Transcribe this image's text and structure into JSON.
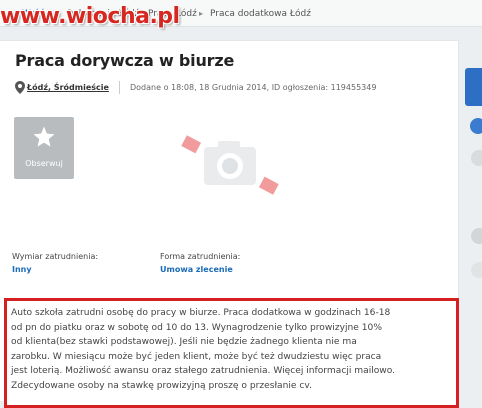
{
  "breadcrumb": {
    "items": [
      "Wróć",
      "Ogłoszenia Łódź",
      "Praca Łódź",
      "Praca dodatkowa Łódź"
    ]
  },
  "watermark": "www.wiocha.pl",
  "listing": {
    "title": "Praca dorywcza w biurze",
    "location": "Łódź, Śródmieście",
    "meta": "Dodane o 18:08, 18 Grudnia 2014, ID ogłoszenia: 119455349",
    "observe_label": "Obserwuj",
    "details": [
      {
        "label": "Wymiar zatrudnienia:",
        "value": "Inny"
      },
      {
        "label": "Forma zatrudnienia:",
        "value": "Umowa zlecenie"
      }
    ],
    "description_lines": [
      "Auto szkoła zatrudni osobę do pracy w biurze. Praca dodatkowa w godzinach 16-18",
      "od pn do piatku oraz w sobotę od 10 do 13. Wynagrodzenie tylko prowizyjne 10%",
      "od klienta(bez stawki podstawowej). Jeśli nie będzie żadnego klienta nie ma",
      "zarobku. W miesiącu może być jeden klient, może być też dwudziestu więc praca",
      "jest loterią. Możliwość awansu oraz stałego zatrudnienia. Więcej informacji mailowo.",
      "Zdecydowane osoby na stawkę prowizyjną proszę o przesłanie cv."
    ]
  },
  "colors": {
    "accent_blue": "#1a6bb8",
    "highlight_red": "#d42020",
    "watermark_red": "#d62720"
  }
}
